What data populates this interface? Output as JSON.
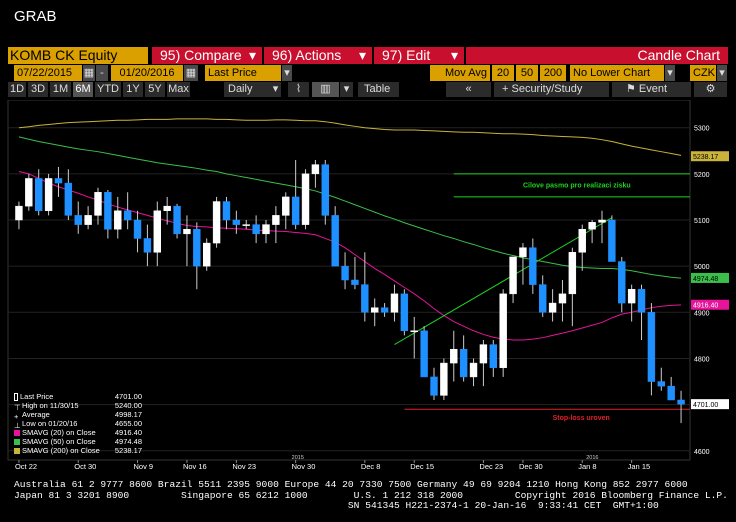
{
  "window": {
    "title": "GRAB"
  },
  "toolbar": {
    "ticker": "KOMB CK Equity",
    "compare": "95) Compare",
    "actions": "96) Actions",
    "edit": "97) Edit",
    "chart_type": "Candle Chart"
  },
  "controls": {
    "start_date": "07/22/2015",
    "end_date": "01/20/2016",
    "field": "Last Price",
    "mov_avg_label": "Mov Avg",
    "ma1": "20",
    "ma2": "50",
    "ma3": "200",
    "lower_chart": "No Lower Chart",
    "currency": "CZK"
  },
  "periods": [
    "1D",
    "3D",
    "1M",
    "6M",
    "YTD",
    "1Y",
    "5Y",
    "Max"
  ],
  "active_period": "6M",
  "frequency": "Daily",
  "table_label": "Table",
  "security_study_label": "Security/Study",
  "event_label": "Event",
  "colors": {
    "up": "#ffffff",
    "down": "#1e90ff",
    "sma20": "#e6149a",
    "sma50": "#3bbf4a",
    "sma200": "#c9b33a",
    "annotation_green": "#1fd11f",
    "annotation_red": "#e0202a"
  },
  "chart_data": {
    "type": "candlestick",
    "y_range": [
      4580,
      5360
    ],
    "yticks": [
      4600,
      4700,
      4800,
      4900,
      5000,
      5100,
      5200,
      5300
    ],
    "xtick_labels": [
      "Oct 22",
      "Oct 30",
      "Nov 9",
      "Nov 16",
      "Nov 23",
      "Nov 30",
      "Dec 8",
      "Dec 15",
      "Dec 23",
      "Dec 30",
      "Jan 8",
      "Jan 15"
    ],
    "year_labels": [
      "2015",
      "2016"
    ],
    "candles": [
      [
        5100,
        5140,
        5080,
        5130
      ],
      [
        5130,
        5200,
        5120,
        5190
      ],
      [
        5190,
        5210,
        5110,
        5120
      ],
      [
        5120,
        5200,
        5110,
        5190
      ],
      [
        5190,
        5215,
        5150,
        5180
      ],
      [
        5180,
        5210,
        5100,
        5110
      ],
      [
        5110,
        5140,
        5070,
        5090
      ],
      [
        5090,
        5130,
        5080,
        5110
      ],
      [
        5110,
        5170,
        5090,
        5160
      ],
      [
        5160,
        5165,
        5060,
        5080
      ],
      [
        5080,
        5150,
        5060,
        5120
      ],
      [
        5120,
        5160,
        5080,
        5100
      ],
      [
        5100,
        5120,
        5030,
        5060
      ],
      [
        5060,
        5090,
        5000,
        5030
      ],
      [
        5030,
        5140,
        5000,
        5120
      ],
      [
        5120,
        5150,
        5090,
        5130
      ],
      [
        5130,
        5135,
        5060,
        5070
      ],
      [
        5070,
        5110,
        5000,
        5080
      ],
      [
        5080,
        5095,
        4950,
        5000
      ],
      [
        5000,
        5060,
        4990,
        5050
      ],
      [
        5050,
        5150,
        5040,
        5140
      ],
      [
        5140,
        5150,
        5080,
        5100
      ],
      [
        5100,
        5120,
        5070,
        5090
      ],
      [
        5090,
        5100,
        5080,
        5090
      ],
      [
        5090,
        5110,
        5050,
        5070
      ],
      [
        5070,
        5100,
        5050,
        5090
      ],
      [
        5090,
        5130,
        5050,
        5110
      ],
      [
        5110,
        5160,
        5080,
        5150
      ],
      [
        5150,
        5230,
        5080,
        5090
      ],
      [
        5090,
        5210,
        5080,
        5200
      ],
      [
        5200,
        5230,
        5170,
        5220
      ],
      [
        5220,
        5230,
        5090,
        5110
      ],
      [
        5110,
        5130,
        5000,
        5000
      ],
      [
        5000,
        5030,
        4950,
        4970
      ],
      [
        4970,
        5020,
        4950,
        4960
      ],
      [
        4960,
        5030,
        4880,
        4900
      ],
      [
        4900,
        4930,
        4870,
        4910
      ],
      [
        4910,
        4920,
        4890,
        4900
      ],
      [
        4900,
        4960,
        4880,
        4940
      ],
      [
        4940,
        4950,
        4850,
        4860
      ],
      [
        4860,
        4890,
        4800,
        4860
      ],
      [
        4860,
        4870,
        4760,
        4760
      ],
      [
        4760,
        4780,
        4710,
        4720
      ],
      [
        4720,
        4800,
        4710,
        4790
      ],
      [
        4790,
        4860,
        4750,
        4820
      ],
      [
        4820,
        4850,
        4750,
        4760
      ],
      [
        4760,
        4800,
        4740,
        4790
      ],
      [
        4790,
        4840,
        4740,
        4830
      ],
      [
        4830,
        4840,
        4760,
        4780
      ],
      [
        4780,
        4950,
        4760,
        4940
      ],
      [
        4940,
        5020,
        4920,
        5020
      ],
      [
        5020,
        5050,
        4960,
        5040
      ],
      [
        5040,
        5060,
        4940,
        4960
      ],
      [
        4960,
        4980,
        4890,
        4900
      ],
      [
        4900,
        4950,
        4880,
        4920
      ],
      [
        4920,
        4970,
        4880,
        4940
      ],
      [
        4940,
        5040,
        4870,
        5030
      ],
      [
        5030,
        5090,
        4990,
        5080
      ],
      [
        5080,
        5100,
        5050,
        5095
      ],
      [
        5095,
        5120,
        5050,
        5100
      ],
      [
        5100,
        5110,
        5060,
        5010
      ],
      [
        5010,
        5020,
        4900,
        4920
      ],
      [
        4920,
        4960,
        4880,
        4950
      ],
      [
        4950,
        4960,
        4840,
        4900
      ],
      [
        4900,
        4920,
        4720,
        4750
      ],
      [
        4750,
        4780,
        4730,
        4740
      ],
      [
        4740,
        4760,
        4720,
        4710
      ],
      [
        4710,
        4730,
        4660,
        4701
      ]
    ],
    "sma200": [
      5300,
      5302,
      5305,
      5307,
      5309,
      5311,
      5312,
      5313,
      5314,
      5315,
      5316,
      5316,
      5317,
      5318,
      5318,
      5318,
      5319,
      5319,
      5319,
      5319,
      5318,
      5318,
      5317,
      5316,
      5316,
      5316,
      5317,
      5317,
      5316,
      5315,
      5315,
      5313,
      5310,
      5306,
      5303,
      5300,
      5298,
      5296,
      5295,
      5295,
      5295,
      5294,
      5293,
      5292,
      5291,
      5290,
      5290,
      5289,
      5288,
      5287,
      5287,
      5286,
      5285,
      5283,
      5282,
      5281,
      5280,
      5279,
      5277,
      5274,
      5270,
      5265,
      5260,
      5256,
      5252,
      5248,
      5244,
      5240
    ],
    "sma50": [
      5280,
      5275,
      5270,
      5266,
      5262,
      5258,
      5254,
      5251,
      5248,
      5244,
      5240,
      5236,
      5232,
      5228,
      5224,
      5221,
      5218,
      5215,
      5212,
      5208,
      5205,
      5200,
      5196,
      5192,
      5188,
      5184,
      5180,
      5176,
      5172,
      5168,
      5163,
      5156,
      5149,
      5141,
      5133,
      5125,
      5117,
      5109,
      5102,
      5094,
      5087,
      5080,
      5073,
      5066,
      5060,
      5053,
      5047,
      5040,
      5034,
      5028,
      5023,
      5018,
      5014,
      5010,
      5006,
      5002,
      4999,
      4997,
      4996,
      4995,
      4995,
      4993,
      4990,
      4986,
      4982,
      4979,
      4976,
      4974
    ],
    "sma20": [
      5205,
      5200,
      5190,
      5180,
      5172,
      5165,
      5158,
      5150,
      5143,
      5135,
      5128,
      5122,
      5116,
      5110,
      5104,
      5098,
      5093,
      5088,
      5086,
      5085,
      5083,
      5082,
      5081,
      5080,
      5078,
      5077,
      5076,
      5075,
      5073,
      5071,
      5068,
      5060,
      5052,
      5040,
      5025,
      5010,
      4995,
      4982,
      4968,
      4954,
      4940,
      4925,
      4908,
      4893,
      4880,
      4870,
      4860,
      4852,
      4846,
      4842,
      4840,
      4840,
      4842,
      4845,
      4850,
      4855,
      4860,
      4866,
      4872,
      4878,
      4888,
      4896,
      4900,
      4905,
      4910,
      4913,
      4915,
      4916
    ],
    "target_zone": {
      "label": "Cilove pasmo pro realizaci zisku",
      "upper": 5200,
      "lower": 5150
    },
    "stop_loss": {
      "label": "Stop-loss uroven",
      "level": 4690
    },
    "trendline": {
      "from_index": 38,
      "from_value": 4830,
      "to_index": 60,
      "to_value": 5105
    },
    "badges": [
      {
        "label": "5238.17",
        "value": 5238.17,
        "color": "#c9b33a",
        "text_color": "#000"
      },
      {
        "label": "4974.48",
        "value": 4974.48,
        "color": "#3bbf4a",
        "text_color": "#000"
      },
      {
        "label": "4916.40",
        "value": 4916.4,
        "color": "#e6149a",
        "text_color": "#fff"
      },
      {
        "label": "4701.00",
        "value": 4701.0,
        "color": "#ffffff",
        "text_color": "#000"
      }
    ]
  },
  "legend": {
    "rows": [
      {
        "label": "Last Price",
        "value": "4701.00",
        "icon": "bar-icon"
      },
      {
        "label": "High on 11/30/15",
        "value": "5240.00",
        "icon": "high-marker-icon"
      },
      {
        "label": "Average",
        "value": "4998.17",
        "icon": "average-marker-icon"
      },
      {
        "label": "Low on 01/20/16",
        "value": "4655.00",
        "icon": "low-marker-icon"
      },
      {
        "label": "SMAVG (20) on Close",
        "value": "4916.40",
        "color": "#e6149a"
      },
      {
        "label": "SMAVG (50) on Close",
        "value": "4974.48",
        "color": "#3bbf4a"
      },
      {
        "label": "SMAVG (200) on Close",
        "value": "5238.17",
        "color": "#c9b33a"
      }
    ]
  },
  "footer": {
    "line1": "Australia 61 2 9777 8600 Brazil 5511 2395 9000 Europe 44 20 7330 7500 Germany 49 69 9204 1210 Hong Kong 852 2977 6000",
    "line2": "Japan 81 3 3201 8900         Singapore 65 6212 1000        U.S. 1 212 318 2000         Copyright 2016 Bloomberg Finance L.P.",
    "line3": "                                                          SN 541345 H221-2374-1 20-Jan-16  9:33:41 CET  GMT+1:00"
  }
}
